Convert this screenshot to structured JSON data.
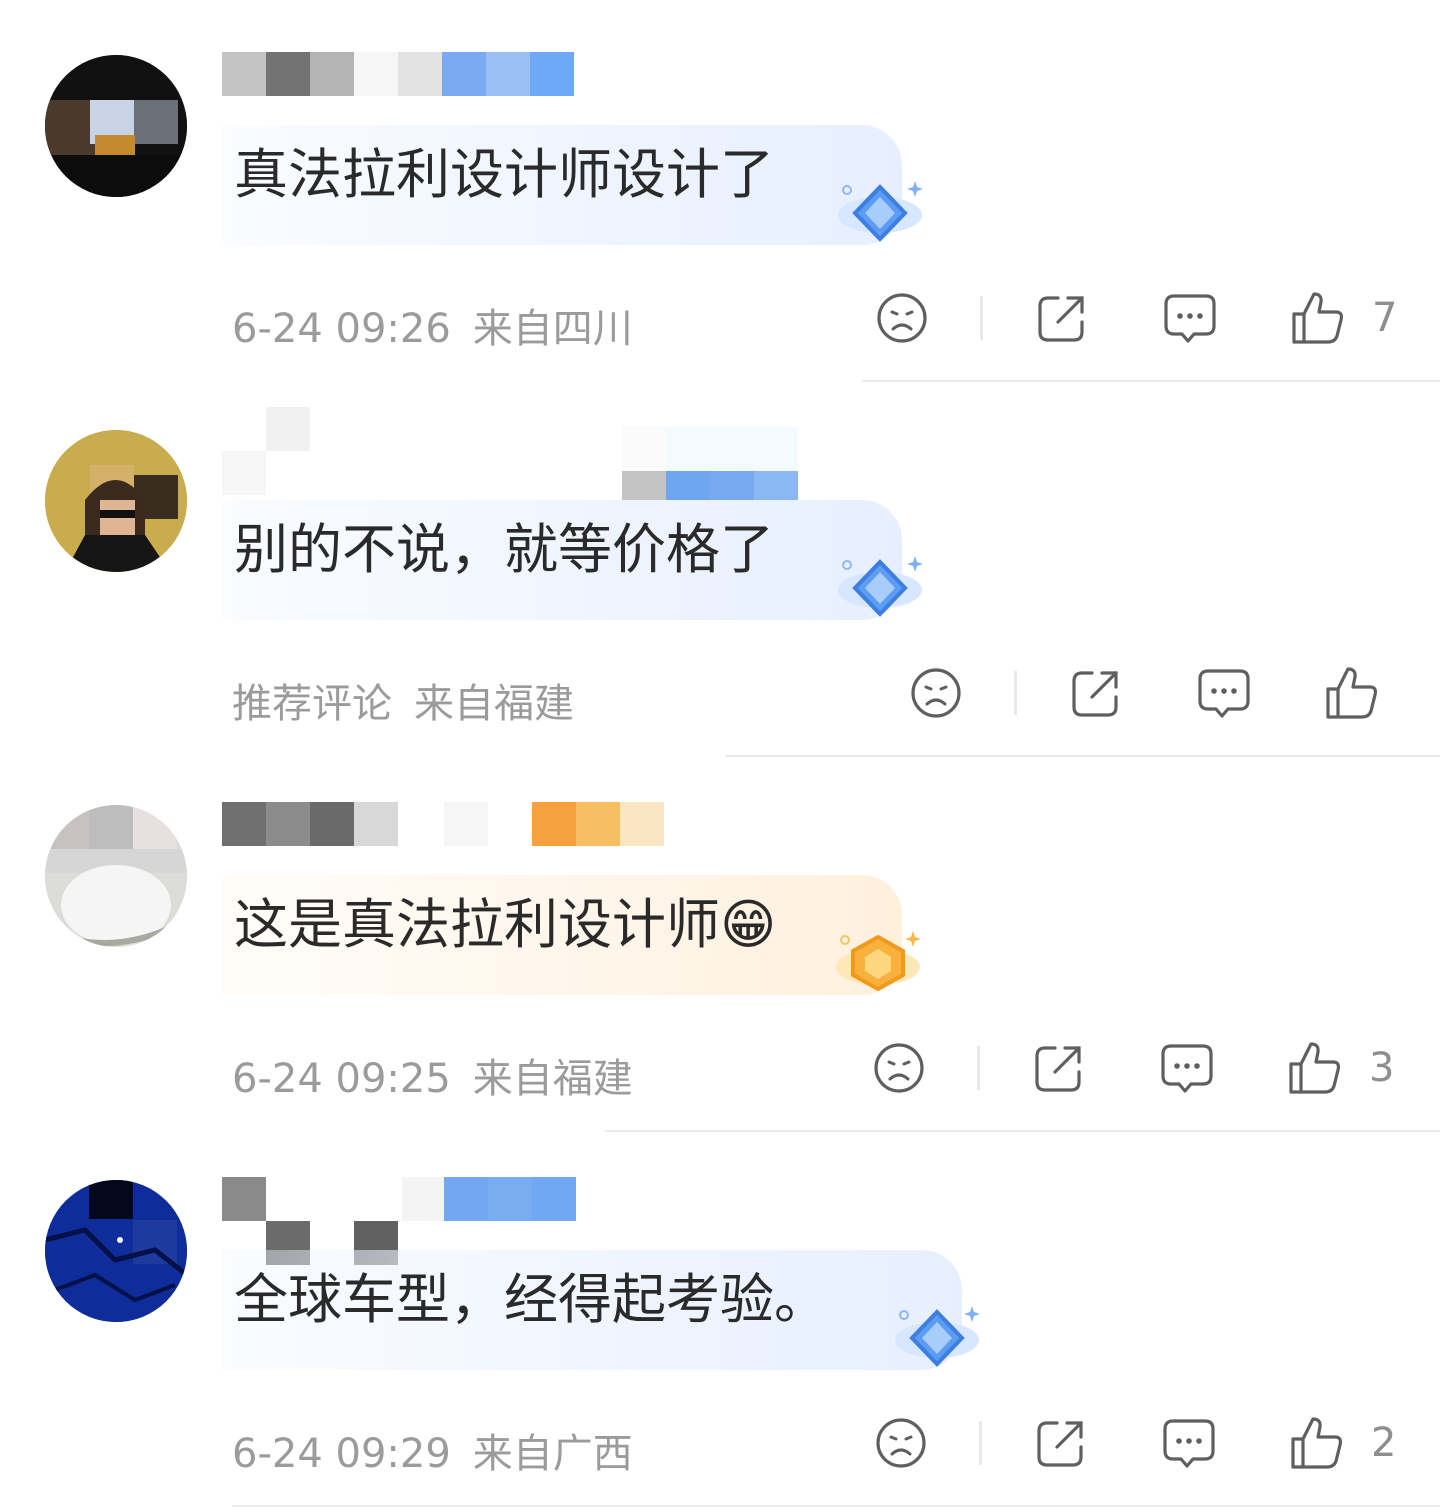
{
  "comments": [
    {
      "text": "真法拉利设计师设计了",
      "meta_time": "6-24 09:26",
      "meta_location": "来自四川",
      "likes": "7",
      "badge": "blue"
    },
    {
      "text": "别的不说，就等价格了",
      "meta_time": "推荐评论",
      "meta_location": "来自福建",
      "likes": "",
      "badge": "blue"
    },
    {
      "text": "这是真法拉利设计师😁",
      "meta_time": "6-24 09:25",
      "meta_location": "来自福建",
      "likes": "3",
      "badge": "gold"
    },
    {
      "text": "全球车型，经得起考验。",
      "meta_time": "6-24 09:29",
      "meta_location": "来自广西",
      "likes": "2",
      "badge": "blue"
    }
  ],
  "icons": {
    "dislike": "sad-face-icon",
    "share": "share-icon",
    "reply": "comment-bubble-icon",
    "like": "thumbs-up-icon"
  },
  "colors": {
    "text": "#2a2a2a",
    "meta": "#9b9b9b",
    "icon": "#5f5f5f",
    "blue_accent": "#6ea9f5",
    "gold_accent": "#f7b13c"
  }
}
